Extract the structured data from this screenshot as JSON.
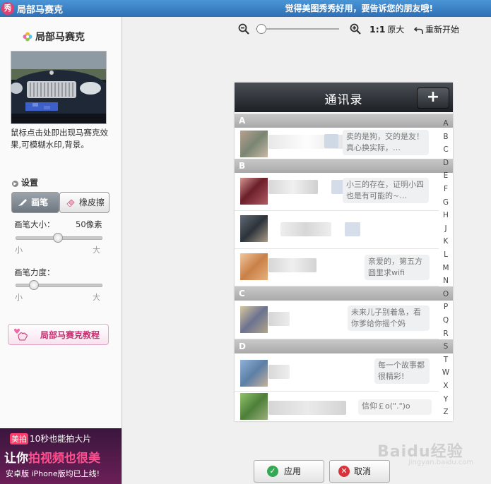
{
  "titlebar": {
    "logo": "秀",
    "title": "局部马赛克",
    "slogan": "觉得美图秀秀好用，要告诉您的朋友哦!"
  },
  "sidebar": {
    "heading": "局部马赛克",
    "description": "鼠标点击处即出现马赛克效果,可模糊水印,背景。",
    "settings_label": "设置",
    "brush_label": "画笔",
    "eraser_label": "橡皮擦",
    "brush_size": {
      "label": "画笔大小：",
      "value": "50像素",
      "min_label": "小",
      "max_label": "大",
      "level": 0.49
    },
    "brush_strength": {
      "label": "画笔力度：",
      "min_label": "小",
      "max_label": "大",
      "level": 0.21
    },
    "tutorial_label": "局部马赛克教程"
  },
  "ad": {
    "logo": "美拍",
    "line1": "10秒也能拍大片",
    "line2_prefix": "让你",
    "line2_highlight": "拍视频也很美",
    "line3": "安卓版 iPhone版均已上线!"
  },
  "toolbar": {
    "zoom_level": 0.0,
    "orig_size_ratio": "1:1",
    "orig_size_label": "原大",
    "reset_label": "重新开始"
  },
  "phone": {
    "title": "通讯录",
    "add_label": "+",
    "sections": [
      "A",
      "B",
      "C",
      "D"
    ],
    "messages": [
      "卖的是狗，交的是友！真心换实际，…",
      "小三的存在，证明小四也是有可能的~…",
      "亲爱的，第五方圆里求wifi",
      "未来儿子别着急，看你爹给你摇个妈",
      "每一个故事都很精彩!",
      "信仰￡o(\".\")o"
    ],
    "index_letters": [
      "A",
      "B",
      "C",
      "D",
      "E",
      "F",
      "G",
      "H",
      "J",
      "K",
      "L",
      "M",
      "N",
      "O",
      "P",
      "Q",
      "R",
      "S",
      "T",
      "W",
      "X",
      "Y",
      "Z"
    ]
  },
  "buttons": {
    "apply_label": "应用",
    "cancel_label": "取消"
  },
  "watermark": {
    "main": "Baidu经验",
    "sub": "jingyan.baidu.com"
  },
  "colors": {
    "titlebar": "#2f6fb5",
    "accent_pink": "#c2306f",
    "apply_green": "#34a853",
    "cancel_red": "#d9323b"
  }
}
